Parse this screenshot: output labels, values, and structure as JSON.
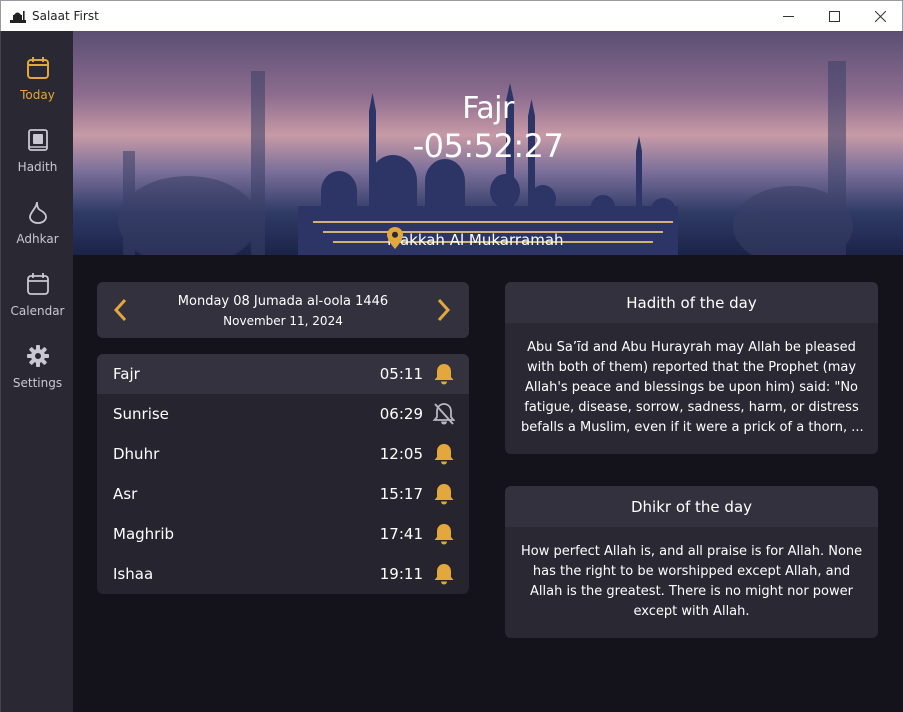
{
  "window": {
    "title": "Salaat First",
    "minimize_glyph": "─",
    "maximize_glyph": "☐",
    "close_glyph": "✕"
  },
  "sidebar": {
    "items": [
      {
        "label": "Today",
        "icon": "calendar-today-icon",
        "active": true
      },
      {
        "label": "Hadith",
        "icon": "book-icon",
        "active": false
      },
      {
        "label": "Adhkar",
        "icon": "drop-icon",
        "active": false
      },
      {
        "label": "Calendar",
        "icon": "calendar-icon",
        "active": false
      },
      {
        "label": "Settings",
        "icon": "gear-icon",
        "active": false
      }
    ]
  },
  "hero": {
    "next_prayer": "Fajr",
    "countdown": "-05:52:27",
    "location": "Makkah Al Mukarramah"
  },
  "date": {
    "hijri": "Monday 08 Jumada al-oola 1446",
    "gregorian": "November 11, 2024"
  },
  "prayers": [
    {
      "name": "Fajr",
      "time": "05:11",
      "alert": "on",
      "current": true
    },
    {
      "name": "Sunrise",
      "time": "06:29",
      "alert": "off",
      "current": false
    },
    {
      "name": "Dhuhr",
      "time": "12:05",
      "alert": "on",
      "current": false
    },
    {
      "name": "Asr",
      "time": "15:17",
      "alert": "on",
      "current": false
    },
    {
      "name": "Maghrib",
      "time": "17:41",
      "alert": "on",
      "current": false
    },
    {
      "name": "Ishaa",
      "time": "19:11",
      "alert": "on",
      "current": false
    }
  ],
  "hadith": {
    "title": "Hadith of the day",
    "lines": [
      "Abu Sa’īd and Abu Hurayrah may Allah be pleased",
      "with both of them) reported that the Prophet (may",
      "Allah's peace and blessings be upon him) said: \"No",
      "fatigue, disease, sorrow, sadness, harm, or distress",
      "befalls a Muslim, even if it were a prick of a thorn, ..."
    ]
  },
  "dhikr": {
    "title": "Dhikr of the day",
    "lines": [
      "How perfect Allah is, and all praise is for Allah. None",
      "has the right to be worshipped except Allah, and",
      "Allah is the greatest. There is no might nor power",
      "except with Allah."
    ]
  },
  "colors": {
    "accent": "#e2a73d",
    "sidebar": "#2a2833",
    "background": "#14121b",
    "card": "#33313d",
    "muted_bell": "#b8b6be"
  }
}
